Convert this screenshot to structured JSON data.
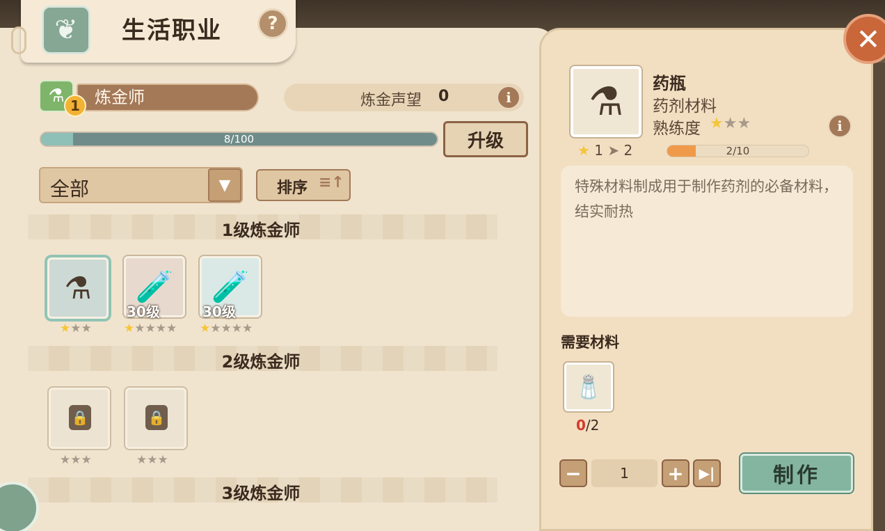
{
  "header": {
    "title": "生活职业",
    "help_icon": "?",
    "close_icon": "✕"
  },
  "profession": {
    "name": "炼金师",
    "level": "1",
    "reputation_label": "炼金声望",
    "reputation_value": "0",
    "xp_text": "8/100",
    "xp_progress": 0.08,
    "upgrade_label": "升级"
  },
  "filter": {
    "selected": "全部",
    "sort_label": "排序"
  },
  "sections": [
    {
      "title": "1级炼金师"
    },
    {
      "title": "2级炼金师"
    },
    {
      "title": "3级炼金师"
    }
  ],
  "items": [
    {
      "icon": "flask-empty-icon",
      "glyph": "⚗",
      "level": "",
      "stars_on": 1,
      "stars_total": 3,
      "locked": false,
      "selected": true
    },
    {
      "icon": "flask-red-icon",
      "glyph": "🧪",
      "level": "30级",
      "stars_on": 1,
      "stars_total": 5,
      "locked": false,
      "selected": false
    },
    {
      "icon": "flask-blue-icon",
      "glyph": "🧪",
      "level": "30级",
      "stars_on": 1,
      "stars_total": 5,
      "locked": false,
      "selected": false
    },
    {
      "icon": "flower-icon",
      "glyph": "",
      "level": "",
      "stars_on": 0,
      "stars_total": 3,
      "locked": true,
      "selected": false
    },
    {
      "icon": "lamp-icon",
      "glyph": "",
      "level": "",
      "stars_on": 0,
      "stars_total": 3,
      "locked": true,
      "selected": false
    }
  ],
  "detail": {
    "name": "药瓶",
    "type": "药剂材料",
    "proficiency_label": "熟练度",
    "rank_from": "1",
    "rank_to": "2",
    "proficiency_text": "2/10",
    "proficiency_progress": 0.2,
    "description": "特殊材料制成用于制作药剂的必备材料，结实耐热",
    "materials_label": "需要材料",
    "material_have": "0",
    "material_need": "/2",
    "quantity": "1",
    "make_label": "制作"
  },
  "colors": {
    "accent_green": "#83b5a1",
    "brown": "#a37958",
    "star": "#f5c53a",
    "warning": "#d63a2c"
  }
}
